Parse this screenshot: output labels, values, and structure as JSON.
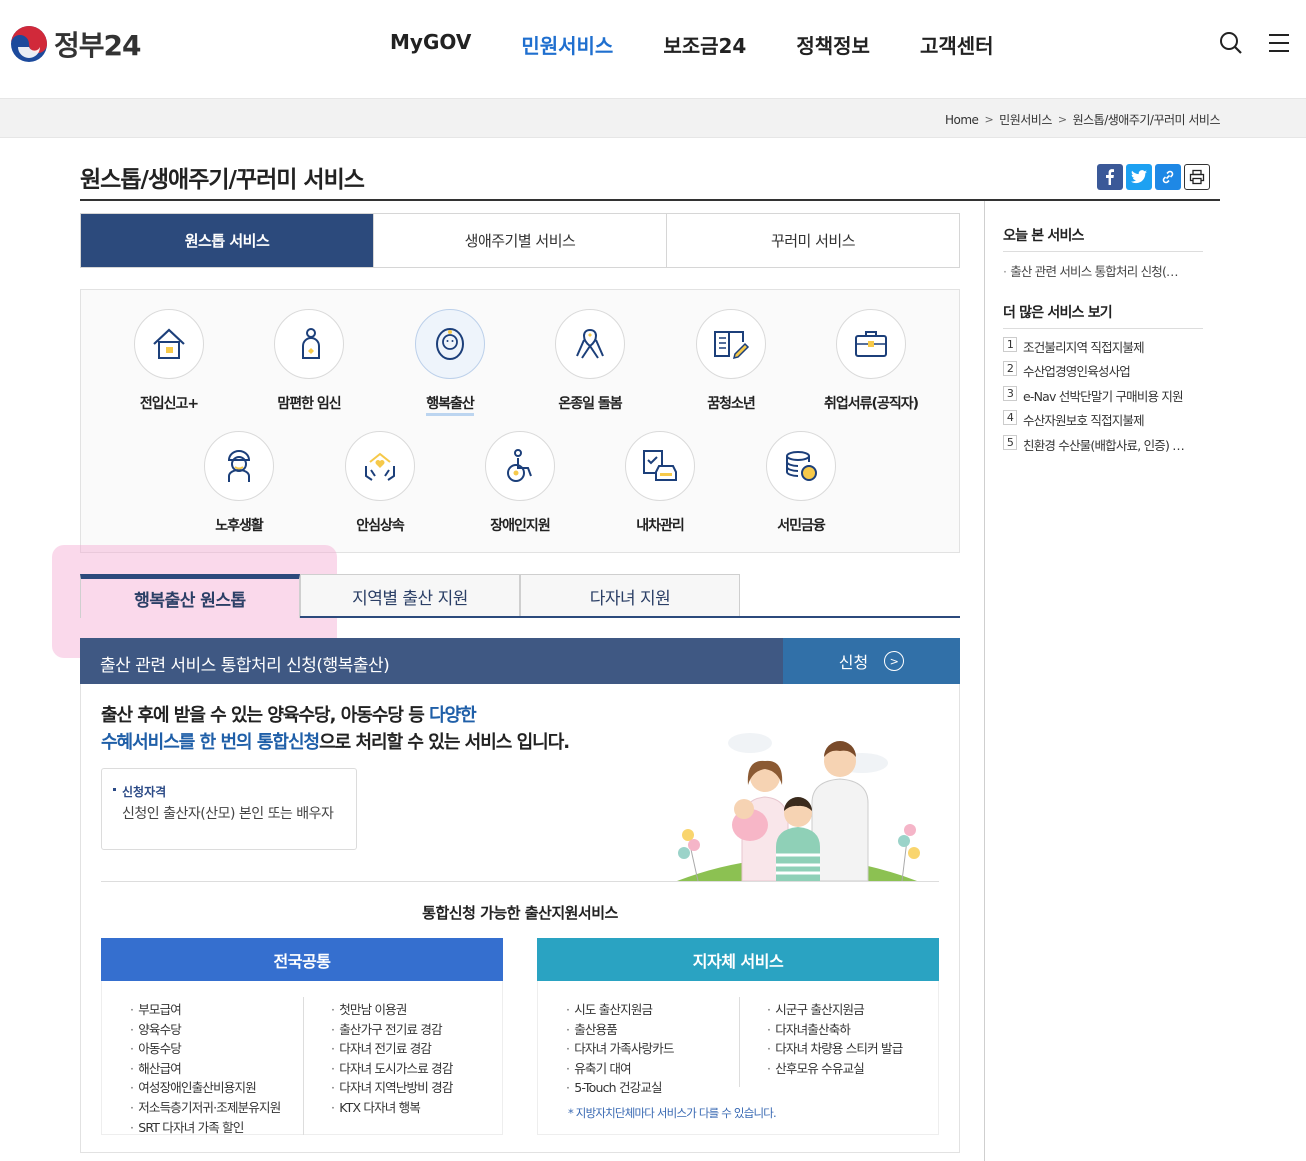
{
  "header": {
    "logo_text": "정부24",
    "nav": [
      "MyGOV",
      "민원서비스",
      "보조금24",
      "정책정보",
      "고객센터"
    ],
    "active_nav": "민원서비스"
  },
  "breadcrumb": [
    "Home",
    "민원서비스",
    "원스톱/생애주기/꾸러미 서비스"
  ],
  "page_title": "원스톱/생애주기/꾸러미 서비스",
  "main_tabs": [
    "원스톱 서비스",
    "생애주기별 서비스",
    "꾸러미 서비스"
  ],
  "services": [
    {
      "label": "전입신고+",
      "icon": "house-icon"
    },
    {
      "label": "맘편한 임신",
      "icon": "pregnant-icon"
    },
    {
      "label": "행복출산",
      "icon": "baby-icon"
    },
    {
      "label": "온종일 돌봄",
      "icon": "ribbon-icon"
    },
    {
      "label": "꿈청소년",
      "icon": "book-pen-icon"
    },
    {
      "label": "취업서류(공직자)",
      "icon": "briefcase-icon"
    },
    {
      "label": "노후생활",
      "icon": "elderly-icon"
    },
    {
      "label": "안심상속",
      "icon": "hands-heart-icon"
    },
    {
      "label": "장애인지원",
      "icon": "wheelchair-icon"
    },
    {
      "label": "내차관리",
      "icon": "car-check-icon"
    },
    {
      "label": "서민금융",
      "icon": "coins-icon"
    }
  ],
  "sub_tabs": [
    "행복출산 원스톱",
    "지역별 출산 지원",
    "다자녀 지원"
  ],
  "service_bar": {
    "title": "출산 관련 서비스 통합처리 신청(행복출산)",
    "apply_label": "신청"
  },
  "description": {
    "line1_a": "출산 후에 받을 수 있는 양육수당, 아동수당 등 ",
    "line1_b": "다양한",
    "line2_a": "수혜서비스를 한 번의 통합신청",
    "line2_b": "으로 처리할 수 있는 서비스 입니다."
  },
  "eligibility": {
    "title": "신청자격",
    "value": "신청인 출산자(산모) 본인 또는 배우자"
  },
  "integrated_title": "통합신청 가능한 출산지원서비스",
  "national": {
    "title": "전국공통",
    "left": [
      "부모급여",
      "양육수당",
      "아동수당",
      "해산급여",
      "여성장애인출산비용지원",
      "저소득층기저귀·조제분유지원",
      "SRT 다자녀 가족 할인"
    ],
    "right": [
      "첫만남 이용권",
      "출산가구 전기료 경감",
      "다자녀 전기료 경감",
      "다자녀 도시가스료 경감",
      "다자녀 지역난방비 경감",
      "KTX 다자녀 행복"
    ]
  },
  "local": {
    "title": "지자체 서비스",
    "left": [
      "시도 출산지원금",
      "출산용품",
      "다자녀 가족사랑카드",
      "유축기 대여",
      "5-Touch 건강교실"
    ],
    "right": [
      "시군구 출산지원금",
      "다자녀출산축하",
      "다자녀 차량용 스티커 발급",
      "산후모유 수유교실"
    ],
    "note": "* 지방자치단체마다 서비스가 다를 수 있습니다."
  },
  "sidebar": {
    "recent_title": "오늘 본 서비스",
    "recent_item": "출산 관련 서비스 통합처리 신청(…",
    "more_title": "더 많은 서비스 보기",
    "more_items": [
      {
        "num": "1",
        "label": "조건불리지역 직접지불제"
      },
      {
        "num": "2",
        "label": "수산업경영인육성사업"
      },
      {
        "num": "3",
        "label": "e-Nav 선박단말기 구매비용 지원"
      },
      {
        "num": "4",
        "label": "수산자원보호 직접지불제"
      },
      {
        "num": "5",
        "label": "친환경 수산물(배합사료, 인증) …"
      }
    ]
  },
  "colors": {
    "primary_navy": "#2c4a7c",
    "nav_active": "#1f6fcf",
    "national_head": "#356fcf",
    "local_head": "#2aa3c2",
    "apply_btn": "#3170a8"
  }
}
